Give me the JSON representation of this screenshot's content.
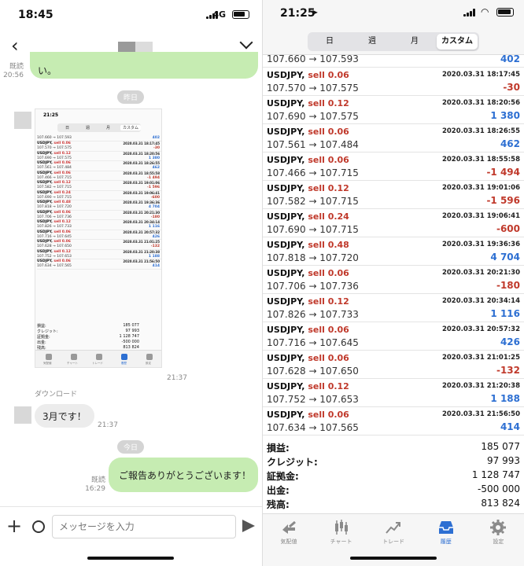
{
  "left": {
    "status": {
      "time": "18:45",
      "network": "4G"
    },
    "chat": {
      "msg1": {
        "read": "既読",
        "time": "20:56",
        "text": "い。"
      },
      "date_yesterday": "昨日",
      "image_time": "21:37",
      "download": "ダウンロード",
      "msg2": {
        "text": "3月です！",
        "time": "21:37"
      },
      "date_today": "今日",
      "msg3": {
        "read": "既読",
        "time": "16:29",
        "text": "ご報告ありがとうございます！"
      }
    },
    "input": {
      "placeholder": "メッセージを入力"
    },
    "thumbnail": {
      "time": "21:25",
      "tabs": [
        "日",
        "週",
        "月",
        "カスタム"
      ],
      "rows": [
        {
          "p": "107.660 → 107.593",
          "v": "402",
          "s": "pos"
        },
        {
          "a": "USDJPY, ",
          "b": "sell 0.06",
          "d": "2020.03.31 18:17:45",
          "p": "107.570 → 107.575",
          "v": "-30",
          "s": "neg"
        },
        {
          "a": "USDJPY, ",
          "b": "sell 0.12",
          "d": "2020.03.31 18:20:56",
          "p": "107.690 → 107.575",
          "v": "1 380",
          "s": "pos"
        },
        {
          "a": "USDJPY, ",
          "b": "sell 0.06",
          "d": "2020.03.31 18:26:55",
          "p": "107.561 → 107.484",
          "v": "462",
          "s": "pos"
        },
        {
          "a": "USDJPY, ",
          "b": "sell 0.06",
          "d": "2020.03.31 18:55:58",
          "p": "107.466 → 107.715",
          "v": "-1 494",
          "s": "neg"
        },
        {
          "a": "USDJPY, ",
          "b": "sell 0.12",
          "d": "2020.03.31 19:01:06",
          "p": "107.582 → 107.715",
          "v": "-1 596",
          "s": "neg"
        },
        {
          "a": "USDJPY, ",
          "b": "sell 0.24",
          "d": "2020.03.31 19:06:41",
          "p": "107.690 → 107.715",
          "v": "-600",
          "s": "neg"
        },
        {
          "a": "USDJPY, ",
          "b": "sell 0.48",
          "d": "2020.03.31 19:36:36",
          "p": "107.818 → 107.720",
          "v": "4 704",
          "s": "pos"
        },
        {
          "a": "USDJPY, ",
          "b": "sell 0.06",
          "d": "2020.03.31 20:21:30",
          "p": "107.706 → 107.736",
          "v": "-180",
          "s": "neg"
        },
        {
          "a": "USDJPY, ",
          "b": "sell 0.12",
          "d": "2020.03.31 20:34:14",
          "p": "107.826 → 107.733",
          "v": "1 116",
          "s": "pos"
        },
        {
          "a": "USDJPY, ",
          "b": "sell 0.06",
          "d": "2020.03.31 20:57:32",
          "p": "107.716 → 107.645",
          "v": "426",
          "s": "pos"
        },
        {
          "a": "USDJPY, ",
          "b": "sell 0.06",
          "d": "2020.03.31 21:01:25",
          "p": "107.628 → 107.650",
          "v": "-132",
          "s": "neg"
        },
        {
          "a": "USDJPY, ",
          "b": "sell 0.12",
          "d": "2020.03.31 21:20:38",
          "p": "107.752 → 107.653",
          "v": "1 188",
          "s": "pos"
        },
        {
          "a": "USDJPY, ",
          "b": "sell 0.06",
          "d": "2020.03.31 21:56:50",
          "p": "107.634 → 107.565",
          "v": "414",
          "s": "pos"
        }
      ],
      "summary": [
        {
          "label": "損益:",
          "value": "185 077"
        },
        {
          "label": "クレジット:",
          "value": "97 993"
        },
        {
          "label": "証拠金:",
          "value": "1 128 747"
        },
        {
          "label": "出金:",
          "value": "-500 000"
        },
        {
          "label": "残高:",
          "value": "813 824"
        }
      ],
      "tabbar": [
        "気配値",
        "チャート",
        "トレード",
        "履歴",
        "設定"
      ]
    }
  },
  "right": {
    "status": {
      "time": "21:25"
    },
    "segments": [
      "日",
      "週",
      "月",
      "カスタム"
    ],
    "first_row": {
      "prices": "107.660 → 107.593",
      "profit": "402"
    },
    "rows": [
      {
        "pair": "USDJPY,",
        "side": "sell 0.06",
        "date": "2020.03.31 18:17:45",
        "prices": "107.570 → 107.575",
        "profit": "-30",
        "sign": "neg"
      },
      {
        "pair": "USDJPY,",
        "side": "sell 0.12",
        "date": "2020.03.31 18:20:56",
        "prices": "107.690 → 107.575",
        "profit": "1 380",
        "sign": "pos"
      },
      {
        "pair": "USDJPY,",
        "side": "sell 0.06",
        "date": "2020.03.31 18:26:55",
        "prices": "107.561 → 107.484",
        "profit": "462",
        "sign": "pos"
      },
      {
        "pair": "USDJPY,",
        "side": "sell 0.06",
        "date": "2020.03.31 18:55:58",
        "prices": "107.466 → 107.715",
        "profit": "-1 494",
        "sign": "neg"
      },
      {
        "pair": "USDJPY,",
        "side": "sell 0.12",
        "date": "2020.03.31 19:01:06",
        "prices": "107.582 → 107.715",
        "profit": "-1 596",
        "sign": "neg"
      },
      {
        "pair": "USDJPY,",
        "side": "sell 0.24",
        "date": "2020.03.31 19:06:41",
        "prices": "107.690 → 107.715",
        "profit": "-600",
        "sign": "neg"
      },
      {
        "pair": "USDJPY,",
        "side": "sell 0.48",
        "date": "2020.03.31 19:36:36",
        "prices": "107.818 → 107.720",
        "profit": "4 704",
        "sign": "pos"
      },
      {
        "pair": "USDJPY,",
        "side": "sell 0.06",
        "date": "2020.03.31 20:21:30",
        "prices": "107.706 → 107.736",
        "profit": "-180",
        "sign": "neg"
      },
      {
        "pair": "USDJPY,",
        "side": "sell 0.12",
        "date": "2020.03.31 20:34:14",
        "prices": "107.826 → 107.733",
        "profit": "1 116",
        "sign": "pos"
      },
      {
        "pair": "USDJPY,",
        "side": "sell 0.06",
        "date": "2020.03.31 20:57:32",
        "prices": "107.716 → 107.645",
        "profit": "426",
        "sign": "pos"
      },
      {
        "pair": "USDJPY,",
        "side": "sell 0.06",
        "date": "2020.03.31 21:01:25",
        "prices": "107.628 → 107.650",
        "profit": "-132",
        "sign": "neg"
      },
      {
        "pair": "USDJPY,",
        "side": "sell 0.12",
        "date": "2020.03.31 21:20:38",
        "prices": "107.752 → 107.653",
        "profit": "1 188",
        "sign": "pos"
      },
      {
        "pair": "USDJPY,",
        "side": "sell 0.06",
        "date": "2020.03.31 21:56:50",
        "prices": "107.634 → 107.565",
        "profit": "414",
        "sign": "pos"
      }
    ],
    "summary": [
      {
        "label": "損益:",
        "value": "185 077"
      },
      {
        "label": "クレジット:",
        "value": "97 993"
      },
      {
        "label": "証拠金:",
        "value": "1 128 747"
      },
      {
        "label": "出金:",
        "value": "-500 000"
      },
      {
        "label": "残高:",
        "value": "813 824"
      }
    ],
    "tabbar": [
      {
        "label": "気配値",
        "icon": "quotes-icon"
      },
      {
        "label": "チャート",
        "icon": "chart-icon"
      },
      {
        "label": "トレード",
        "icon": "trade-icon"
      },
      {
        "label": "履歴",
        "icon": "history-icon",
        "active": true
      },
      {
        "label": "設定",
        "icon": "gear-icon"
      }
    ]
  },
  "colors": {
    "positive": "#2d6fd2",
    "negative": "#c0392b",
    "bubble_out": "#c6ecb2",
    "bubble_in": "#ececec"
  }
}
